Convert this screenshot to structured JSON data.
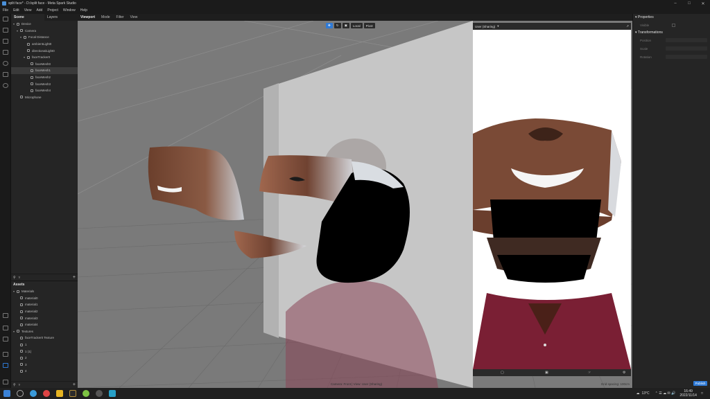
{
  "window": {
    "title": "split face* - D:/split face - Meta Spark Studio"
  },
  "menu": [
    "File",
    "Edit",
    "View",
    "Add",
    "Project",
    "Window",
    "Help"
  ],
  "scene_tabs": [
    "Scene",
    "Layers"
  ],
  "scene_tree": [
    {
      "label": "Device",
      "depth": 0,
      "caret": "▾"
    },
    {
      "label": "Camera",
      "depth": 1,
      "caret": "▾"
    },
    {
      "label": "Focal Distance",
      "depth": 2,
      "caret": "▾"
    },
    {
      "label": "ambientLight0",
      "depth": 3,
      "caret": ""
    },
    {
      "label": "directionalLight0",
      "depth": 3,
      "caret": ""
    },
    {
      "label": "faceTracker0",
      "depth": 3,
      "caret": "▾"
    },
    {
      "label": "faceMesh0",
      "depth": 4,
      "caret": ""
    },
    {
      "label": "faceMesh1",
      "depth": 4,
      "caret": "",
      "selected": true
    },
    {
      "label": "faceMesh2",
      "depth": 4,
      "caret": ""
    },
    {
      "label": "faceMesh3",
      "depth": 4,
      "caret": ""
    },
    {
      "label": "faceMesh4",
      "depth": 4,
      "caret": ""
    },
    {
      "label": "Microphone",
      "depth": 1,
      "caret": ""
    }
  ],
  "assets": {
    "title": "Assets",
    "items": [
      {
        "label": "Materials",
        "depth": 0,
        "caret": "▾"
      },
      {
        "label": "material0",
        "depth": 1,
        "caret": ""
      },
      {
        "label": "material1",
        "depth": 1,
        "caret": ""
      },
      {
        "label": "material2",
        "depth": 1,
        "caret": ""
      },
      {
        "label": "material3",
        "depth": 1,
        "caret": ""
      },
      {
        "label": "material4",
        "depth": 1,
        "caret": ""
      },
      {
        "label": "Textures",
        "depth": 0,
        "caret": "▾"
      },
      {
        "label": "faceTracker0 Texture",
        "depth": 1,
        "caret": ""
      },
      {
        "label": "1",
        "depth": 1,
        "caret": ""
      },
      {
        "label": "1 (1)",
        "depth": 1,
        "caret": ""
      },
      {
        "label": "2",
        "depth": 1,
        "caret": ""
      },
      {
        "label": "3",
        "depth": 1,
        "caret": ""
      },
      {
        "label": "4",
        "depth": 1,
        "caret": ""
      }
    ]
  },
  "viewport_tabs": [
    "Viewport",
    "Mode",
    "Filter",
    "View"
  ],
  "viewport_tools": {
    "local": "Local",
    "pivot": "Pivot"
  },
  "viewport_status": "Camera: Front | View: User (Sharing)",
  "grid_spacing": "Grid spacing: 100cm",
  "simulator": {
    "device": "User (Sharing)"
  },
  "properties": {
    "title": "Properties",
    "visible_label": "Visible",
    "transformations": "Transformations",
    "rows": [
      "Position",
      "Scale",
      "Rotation"
    ]
  },
  "publish_label": "Publish",
  "taskbar": {
    "weather": "13°C",
    "time": "16:49",
    "date": "2022/11/14"
  },
  "colors": {
    "accent": "#2f7ad6",
    "viewport_bg": "#7a7a7a"
  }
}
